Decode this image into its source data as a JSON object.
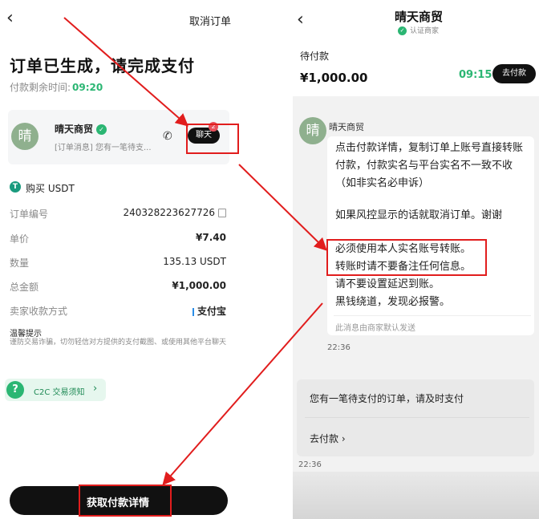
{
  "left": {
    "header": {
      "back_icon": "chevron-left-icon",
      "back_glyph": "‹",
      "cancel_label": "取消订单"
    },
    "title": "订单已生成，请完成支付",
    "timer_label": "付款剩余时间:",
    "timer_value": "09:20",
    "merchant": {
      "avatar_char": "晴",
      "name": "晴天商贸",
      "verified_glyph": "✓",
      "message": "[订单消息] 您有一笔待支...",
      "phone_glyph": "✆",
      "chat_label": "聊天",
      "chat_badge": "2"
    },
    "buy": {
      "icon_char": "T",
      "label": "购买 USDT"
    },
    "details": [
      {
        "label": "订单编号",
        "value": "240328223627726"
      },
      {
        "label": "单价",
        "value": "¥7.40"
      },
      {
        "label": "数量",
        "value": "135.13 USDT"
      },
      {
        "label": "总金额",
        "value": "¥1,000.00"
      },
      {
        "label": "卖家收款方式",
        "value": "支付宝"
      }
    ],
    "tips_title": "温馨提示",
    "tips_text": "谨防交易诈骗，切勿轻信对方提供的支付截图、或使用其他平台聊天",
    "c2c": {
      "icon_char": "?",
      "label": "C2C 交易须知",
      "arrow": "›"
    },
    "main_button": "获取付款详情"
  },
  "right": {
    "header": {
      "back_glyph": "‹",
      "title": "晴天商贸",
      "subtitle": "认证商家",
      "verified_glyph": "✓"
    },
    "status": "待付款",
    "amount": "¥1,000.00",
    "timer": "09:15",
    "pay_button": "去付款",
    "sender": {
      "avatar_char": "晴",
      "name": "晴天商贸"
    },
    "message_paragraphs": [
      "点击付款详情，复制订单上账号直接转账付款，付款实名与平台实名不一致不收 （如非实名必申诉）",
      "如果风控显示的话就取消订单。谢谢",
      "必须使用本人实名账号转账。",
      "转账时请不要备注任何信息。",
      "请不要设置延迟到账。",
      "黑钱绕道，发现必报警。"
    ],
    "auto_note": "此消息由商家默认发送",
    "time1": "22:36",
    "notice_text": "您有一笔待支付的订单，请及时支付",
    "notice_link": "去付款",
    "notice_link_arrow": "›",
    "time2": "22:36"
  },
  "colors": {
    "accent_green": "#2bb673",
    "highlight_red": "#e11d1d",
    "button_black": "#111111"
  }
}
